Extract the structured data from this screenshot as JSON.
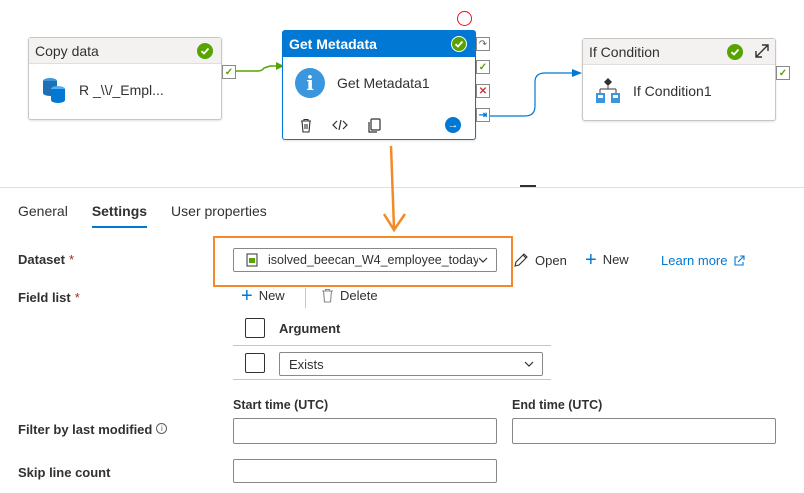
{
  "pipeline": {
    "copy_activity": {
      "title": "Copy data",
      "subtitle": "R       _\\\\/_Empl..."
    },
    "metadata_activity": {
      "title": "Get Metadata",
      "name": "Get Metadata1"
    },
    "if_activity": {
      "title": "If Condition",
      "name": "If Condition1"
    }
  },
  "tabs": [
    {
      "label": "General"
    },
    {
      "label": "Settings"
    },
    {
      "label": "User properties"
    }
  ],
  "form": {
    "dataset_label": "Dataset",
    "dataset_value": "isolved_beecan_W4_employee_today",
    "open_label": "Open",
    "new_label": "New",
    "learn_more_label": "Learn more",
    "field_list_label": "Field list",
    "field_new_label": "New",
    "delete_label": "Delete",
    "argument_header": "Argument",
    "argument_value": "Exists",
    "start_time_label": "Start time (UTC)",
    "end_time_label": "End time (UTC)",
    "filter_label": "Filter by last modified",
    "skip_label": "Skip line count",
    "required_mark": "*"
  },
  "colors": {
    "accent": "#0078d4",
    "success": "#57a300",
    "error": "#d13438",
    "highlight": "#f28a28"
  }
}
